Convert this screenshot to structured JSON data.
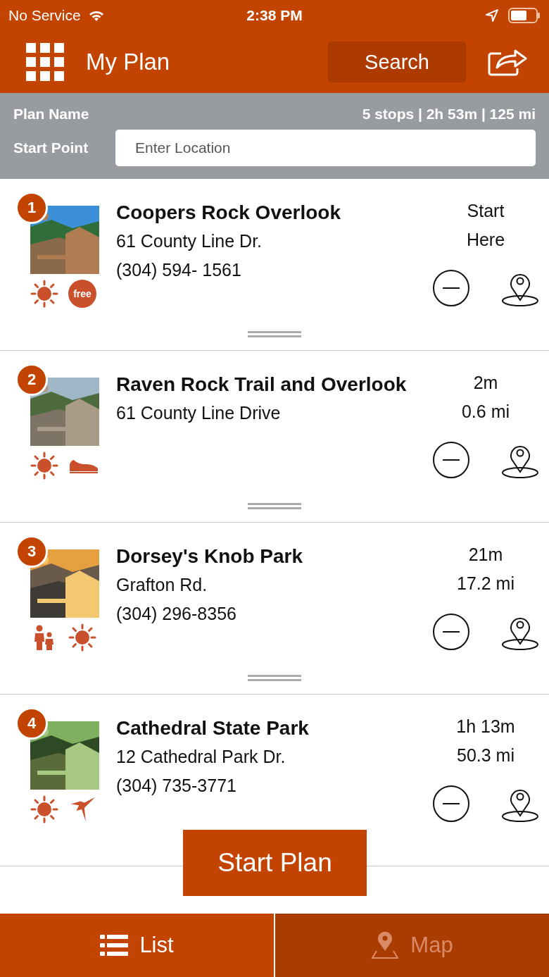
{
  "status_bar": {
    "carrier": "No Service",
    "time": "2:38 PM"
  },
  "header": {
    "title": "My Plan",
    "search_button": "Search"
  },
  "plan": {
    "name_label": "Plan Name",
    "summary": "5 stops | 2h 53m | 125 mi",
    "start_label": "Start Point",
    "start_placeholder": "Enter Location"
  },
  "stops": [
    {
      "number": "1",
      "title": "Coopers Rock Overlook",
      "address": "61 County Line Dr.",
      "phone": "(304) 594- 1561",
      "info": [
        "Start",
        "Here"
      ],
      "amenities": [
        {
          "kind": "sun"
        },
        {
          "kind": "free",
          "label": "free"
        }
      ]
    },
    {
      "number": "2",
      "title": "Raven Rock Trail and Overlook",
      "address": "61 County Line Drive",
      "info": [
        "2m",
        "0.6 mi"
      ],
      "amenities": [
        {
          "kind": "sun"
        },
        {
          "kind": "shoe"
        }
      ]
    },
    {
      "number": "3",
      "title": "Dorsey's Knob Park",
      "address": "Grafton Rd.",
      "phone": "(304) 296-8356",
      "info": [
        "21m",
        "17.2 mi"
      ],
      "amenities": [
        {
          "kind": "family"
        },
        {
          "kind": "sun"
        }
      ]
    },
    {
      "number": "4",
      "title": "Cathedral State Park",
      "address": "12 Cathedral Park Dr.",
      "phone": "(304) 735-3771",
      "info": [
        "1h 13m",
        "50.3 mi"
      ],
      "amenities": [
        {
          "kind": "sun"
        },
        {
          "kind": "bird"
        }
      ]
    }
  ],
  "start_button": "Start Plan",
  "tabs": [
    {
      "label": "List",
      "kind": "list",
      "selected": true
    },
    {
      "label": "Map",
      "kind": "map",
      "selected": false
    }
  ]
}
